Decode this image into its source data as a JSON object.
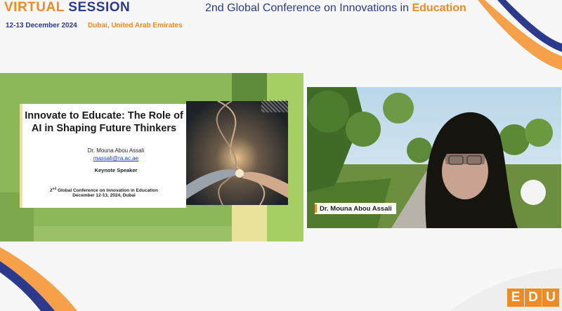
{
  "header": {
    "session_word1": "VIRTUAL",
    "session_word2": "SESSION",
    "dates": "12-13 December 2024",
    "location": "Dubai, United Arab Emirates",
    "conference_prefix": "2nd Global Conference on Innovations in",
    "conference_highlight": "Education"
  },
  "slide": {
    "title": "Innovate to Educate: The Role of AI in Shaping Future Thinkers",
    "author": "Dr. Mouna Abou Assali",
    "email": "massali@ra.ac.ae",
    "role": "Keynote Speaker",
    "conf_num": "2",
    "conf_sup": "nd",
    "conf_line1_rest": " Global Conference on Innovation in Education",
    "conf_line2": "December 12-13, 2024, Dubai"
  },
  "video": {
    "speaker_name": "Dr. Mouna Abou Assali"
  },
  "logo": {
    "letters": [
      "E",
      "D",
      "U"
    ]
  },
  "colors": {
    "brand_orange": "#f08a24",
    "brand_navy": "#2b3a8c",
    "slide_green": "#8cb85a"
  }
}
